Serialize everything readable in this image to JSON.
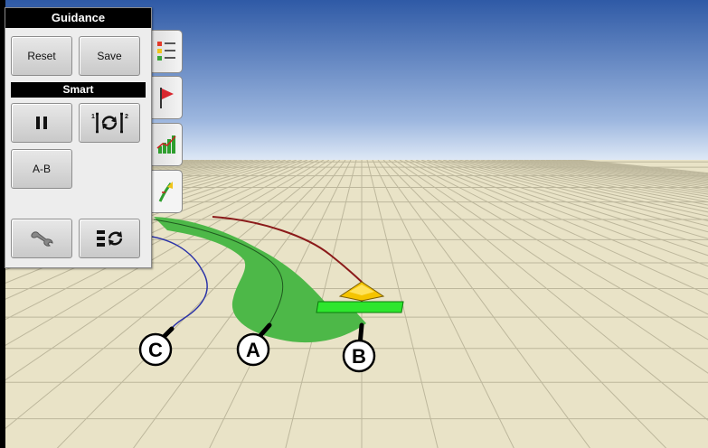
{
  "panel": {
    "title": "Guidance",
    "reset_label": "Reset",
    "save_label": "Save",
    "smart_title": "Smart",
    "ab_label": "A-B"
  },
  "tabs": [
    {
      "icon": "list-icon"
    },
    {
      "icon": "flag-icon"
    },
    {
      "icon": "bar-chart-icon"
    },
    {
      "icon": "guidance-icon"
    }
  ],
  "callouts": {
    "a": "A",
    "b": "B",
    "c": "C"
  },
  "colors": {
    "sky_top": "#2f5aa6",
    "sky_horizon": "#dfe9f6",
    "ground": "#e9e3c7",
    "grid": "#bdb79c",
    "coverage": "#4db848",
    "guidance_line_red": "#8b1a1a",
    "guidance_line_blue": "#2b33a8",
    "implement": "#2ee62e",
    "vehicle": "#f5c400"
  }
}
